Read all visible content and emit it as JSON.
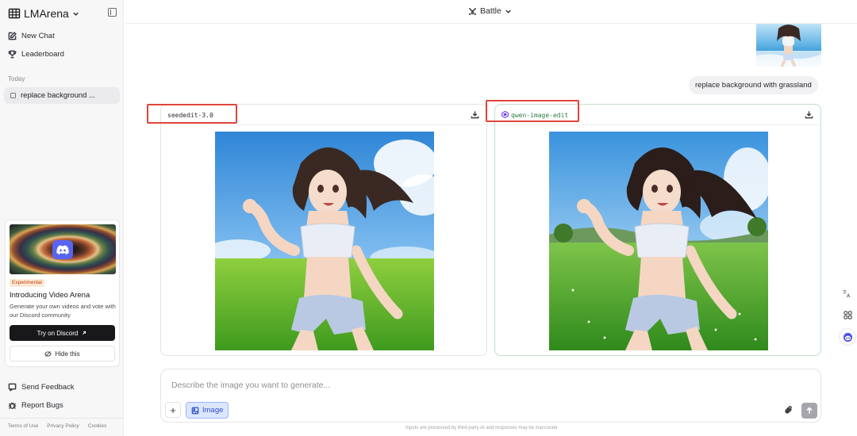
{
  "sidebar": {
    "brand": "LMArena",
    "nav": [
      {
        "label": "New Chat",
        "icon": "edit-icon"
      },
      {
        "label": "Leaderboard",
        "icon": "trophy-icon"
      }
    ],
    "section_today": "Today",
    "chats": [
      {
        "label": "replace background ..."
      }
    ],
    "promo": {
      "badge": "Experimental",
      "title": "Introducing Video Arena",
      "description": "Generate your own videos and vote with our Discord community",
      "primary_label": "Try on Discord",
      "secondary_label": "Hide this"
    },
    "bottom_nav": [
      {
        "label": "Send Feedback",
        "icon": "feedback-icon"
      },
      {
        "label": "Report Bugs",
        "icon": "bug-icon"
      }
    ],
    "footer_links": [
      "Terms of Use",
      "Privacy Policy",
      "Cookies"
    ]
  },
  "header": {
    "mode": "Battle"
  },
  "conversation": {
    "user_prompt": "replace background with grassland",
    "responses": [
      {
        "model": "seededit-3.0"
      },
      {
        "model": "qwen-image-edit"
      }
    ]
  },
  "composer": {
    "placeholder": "Describe the image you want to generate...",
    "image_label": "Image",
    "disclaimer": "Inputs are processed by third-party AI and responses may be inaccurate."
  },
  "colors": {
    "accent_blue": "#2b50c8",
    "highlight_red": "#e0453a",
    "discord": "#5865f2"
  }
}
